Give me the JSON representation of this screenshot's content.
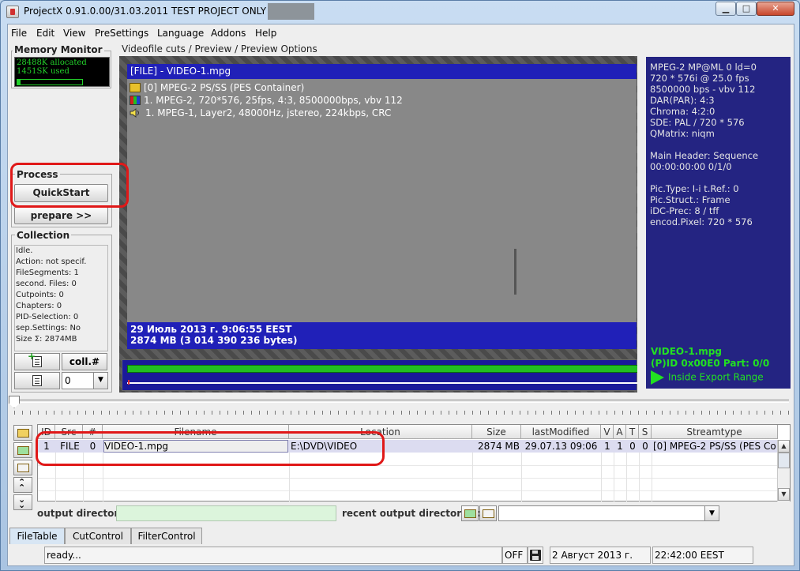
{
  "window": {
    "title": "ProjectX 0.91.0.00/31.03.2011 TEST PROJECT ONLY , User:",
    "buttons": {
      "minimize": "▁",
      "maximize": "□",
      "close": "✕"
    }
  },
  "menu": [
    "File",
    "Edit",
    "View",
    "PreSettings",
    "Language",
    "Addons",
    "Help"
  ],
  "memory_monitor": {
    "title": "Memory Monitor",
    "allocated": "28488K allocated",
    "used": "1451SK used",
    "usage_fraction": 0.05
  },
  "process": {
    "title": "Process",
    "quickstart": "QuickStart",
    "prepare": "prepare >>"
  },
  "collection": {
    "title": "Collection",
    "lines": [
      "Idle.",
      "Action: not specif.",
      "FileSegments: 1",
      "second. Files: 0",
      "Cutpoints: 0",
      "Chapters: 0",
      "PID-Selection: 0",
      "sep.Settings: No",
      "Size Σ: 2874MB"
    ],
    "coll_label": "coll.#",
    "coll_value": "0"
  },
  "preview": {
    "title": "Videofile cuts / Preview / Preview Options",
    "file_header": "[FILE] - VIDEO-1.mpg",
    "streams": [
      {
        "icon": "container-icon",
        "text": "[0] MPEG-2 PS/SS (PES Container)"
      },
      {
        "icon": "video-stream-icon",
        "text": "1. MPEG-2, 720*576, 25fps, 4:3, 8500000bps, vbv 112"
      },
      {
        "icon": "audio-stream-icon",
        "text": "1. MPEG-1, Layer2, 48000Hz, jstereo, 224kbps, CRC"
      }
    ],
    "date_line": "29 Июль 2013 г.  9:06:55 EEST",
    "size_line": "2874 MB (3 014 390 236 bytes)"
  },
  "info_panel": {
    "lines": [
      "MPEG-2  MP@ML 0 ld=0",
      "720 * 576i @ 25.0 fps",
      "8500000 bps - vbv 112",
      "DAR(PAR):  4:3",
      "Chroma:  4:2:0",
      "SDE: PAL / 720 * 576",
      "QMatrix: niqm",
      "",
      "Main Header: Sequence",
      "00:00:00:00   0/1/0",
      "",
      "Pic.Type:  I-i   t.Ref.: 0",
      "Pic.Struct.: Frame",
      "iDC-Prec: 8 / tff",
      "encod.Pixel: 720 * 576"
    ],
    "file_name": "VIDEO-1.mpg",
    "pid_line": "(P)ID 0x00E0   Part: 0/0",
    "export_range": "Inside Export Range"
  },
  "file_table": {
    "columns": [
      "ID",
      "Src",
      "#",
      "Filename",
      "Location",
      "Size",
      "lastModified",
      "V",
      "A",
      "T",
      "S",
      "Streamtype"
    ],
    "rows": [
      [
        "1",
        "FILE",
        "0",
        "VIDEO-1.mpg",
        "E:\\DVD\\VIDEO",
        "2874 MB",
        "29.07.13  09:06",
        "1",
        "1",
        "0",
        "0",
        "[0] MPEG-2 PS/SS (PES Co..."
      ]
    ]
  },
  "output": {
    "dir_label": "output directory:",
    "recent_label": "recent output directories:"
  },
  "tabs": [
    "FileTable",
    "CutControl",
    "FilterControl"
  ],
  "status": {
    "message": "ready...",
    "mode": "OFF",
    "date": "2 Август 2013 г.",
    "time": "22:42:00 EEST"
  },
  "colors": {
    "panel_blue": "#242482",
    "header_blue": "#2020b8",
    "status_green": "#22e022",
    "highlight_red": "#e01818"
  }
}
